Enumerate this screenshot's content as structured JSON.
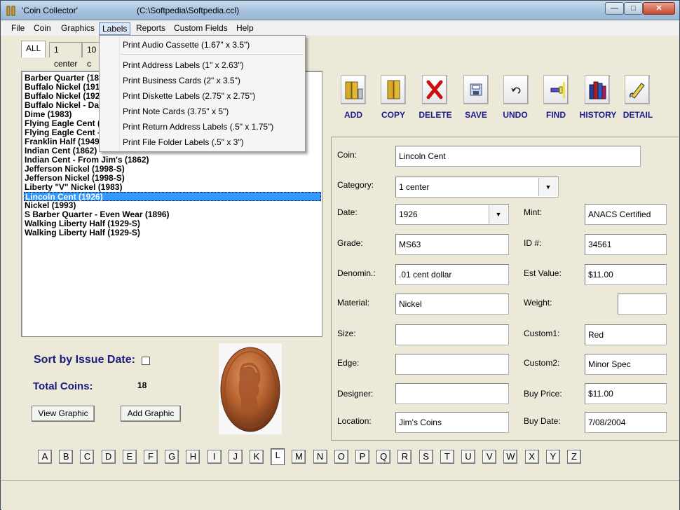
{
  "window": {
    "title": "'Coin Collector'",
    "path": "(C:\\Softpedia\\Softpedia.ccl)"
  },
  "menu": [
    "File",
    "Coin",
    "Graphics",
    "Labels",
    "Reports",
    "Custom Fields",
    "Help"
  ],
  "labels_menu": [
    "Print Audio Cassette (1.67\" x 3.5\")",
    "Print Address Labels (1\" x 2.63\")",
    "Print Business Cards (2\" x 3.5\")",
    "Print Diskette Labels (2.75\" x 2.75\")",
    "Print Note Cards (3.75\" x 5\")",
    "Print Return Address Labels (.5\" x 1.75\")",
    "Print File Folder Labels (.5\" x 3\")"
  ],
  "tabs": [
    "ALL",
    "1 center",
    "10 c"
  ],
  "coin_list": [
    "Barber Quarter (18",
    "Buffalo Nickel (191",
    "Buffalo Nickel (192",
    "Buffalo Nickel - Da",
    "Dime (1983)",
    "Flying Eagle Cent (",
    "Flying Eagle Cent -",
    "Franklin Half (1949",
    "Indian Cent (1862)",
    "Indian Cent - From Jim's (1862)",
    "Jefferson Nickel (1998-S)",
    "Jefferson Nickel (1998-S)",
    "Liberty \"V\" Nickel (1983)",
    "Lincoln Cent (1926)",
    "Nickel (1993)",
    "S Barber Quarter - Even Wear (1896)",
    "Walking Liberty Half (1929-S)",
    "Walking Liberty Half (1929-S)"
  ],
  "selected_index": 13,
  "sort_label": "Sort by Issue Date:",
  "total_label": "Total Coins:",
  "total_value": "18",
  "buttons": {
    "view_graphic": "View Graphic",
    "add_graphic": "Add Graphic"
  },
  "toolbar": [
    "ADD",
    "COPY",
    "DELETE",
    "SAVE",
    "UNDO",
    "FIND",
    "HISTORY",
    "DETAIL"
  ],
  "fields": {
    "coin": {
      "label": "Coin:",
      "value": "Lincoln Cent"
    },
    "category": {
      "label": "Category:",
      "value": "1 center"
    },
    "date": {
      "label": "Date:",
      "value": "1926"
    },
    "mint": {
      "label": "Mint:",
      "value": "ANACS Certified"
    },
    "grade": {
      "label": "Grade:",
      "value": "MS63"
    },
    "id": {
      "label": "ID #:",
      "value": "34561"
    },
    "denomination": {
      "label": "Denomin.:",
      "value": ".01 cent dollar"
    },
    "est_value": {
      "label": "Est Value:",
      "value": "$11.00"
    },
    "material": {
      "label": "Material:",
      "value": "Nickel"
    },
    "weight": {
      "label": "Weight:",
      "value": ""
    },
    "size": {
      "label": "Size:",
      "value": ""
    },
    "custom1": {
      "label": "Custom1:",
      "value": "Red"
    },
    "edge": {
      "label": "Edge:",
      "value": ""
    },
    "custom2": {
      "label": "Custom2:",
      "value": "Minor Spec"
    },
    "designer": {
      "label": "Designer:",
      "value": ""
    },
    "buy_price": {
      "label": "Buy Price:",
      "value": "$11.00"
    },
    "location": {
      "label": "Location:",
      "value": "Jim's Coins"
    },
    "buy_date": {
      "label": "Buy Date:",
      "value": "7/08/2004"
    }
  },
  "alphabet": [
    "A",
    "B",
    "C",
    "D",
    "E",
    "F",
    "G",
    "H",
    "I",
    "J",
    "K",
    "L",
    "M",
    "N",
    "O",
    "P",
    "Q",
    "R",
    "S",
    "T",
    "U",
    "V",
    "W",
    "X",
    "Y",
    "Z"
  ],
  "active_letter": "L"
}
